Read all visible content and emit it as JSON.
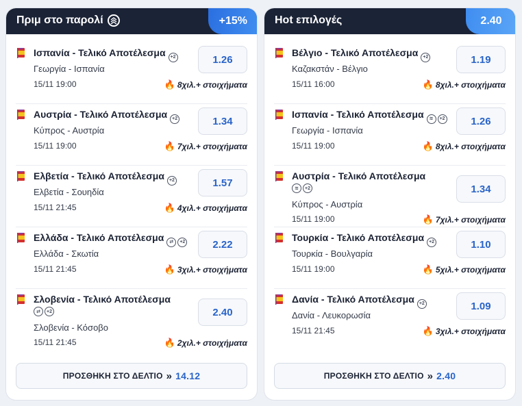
{
  "left": {
    "title": "Πριμ στο παρολί",
    "badge": "+15%",
    "button_label": "ΠΡΟΣΘΗΚΗ ΣΤΟ ΔΕΛΤΙΟ",
    "button_total": "14.12",
    "items": [
      {
        "title": "Ισπανία - Τελικό Αποτέλεσμα",
        "teams": "Γεωργία - Ισπανία",
        "time": "15/11 19:00",
        "odds": "1.26",
        "bets": "8χιλ.+ στοιχήματα",
        "badges": [
          "+2"
        ]
      },
      {
        "title": "Αυστρία - Τελικό Αποτέλεσμα",
        "teams": "Κύπρος - Αυστρία",
        "time": "15/11 19:00",
        "odds": "1.34",
        "bets": "7χιλ.+ στοιχήματα",
        "badges": [
          "+2"
        ]
      },
      {
        "title": "Ελβετία - Τελικό Αποτέλεσμα",
        "teams": "Ελβετία - Σουηδία",
        "time": "15/11 21:45",
        "odds": "1.57",
        "bets": "4χιλ.+ στοιχήματα",
        "badges": [
          "+2"
        ]
      },
      {
        "title": "Ελλάδα - Τελικό Αποτέλεσμα",
        "teams": "Ελλάδα - Σκωτία",
        "time": "15/11 21:45",
        "odds": "2.22",
        "bets": "3χιλ.+ στοιχήματα",
        "badges": [
          "eb",
          "+2"
        ]
      },
      {
        "title": "Σλοβενία - Τελικό Αποτέλεσμα",
        "teams": "Σλοβενία - Κόσοβο",
        "time": "15/11 21:45",
        "odds": "2.40",
        "bets": "2χιλ.+ στοιχήματα",
        "badges": [
          "eb",
          "+2"
        ]
      }
    ]
  },
  "right": {
    "title": "Hot επιλογές",
    "badge": "2.40",
    "button_label": "ΠΡΟΣΘΗΚΗ ΣΤΟ ΔΕΛΤΙΟ",
    "button_total": "2.40",
    "items": [
      {
        "title": "Βέλγιο - Τελικό Αποτέλεσμα",
        "teams": "Καζακστάν - Βέλγιο",
        "time": "15/11 16:00",
        "odds": "1.19",
        "bets": "8χιλ.+ στοιχήματα",
        "badges": [
          "+2"
        ]
      },
      {
        "title": "Ισπανία - Τελικό Αποτέλεσμα",
        "teams": "Γεωργία - Ισπανία",
        "time": "15/11 19:00",
        "odds": "1.26",
        "bets": "8χιλ.+ στοιχήματα",
        "badges": [
          "boost",
          "+2"
        ]
      },
      {
        "title": "Αυστρία - Τελικό Αποτέλεσμα",
        "teams": "Κύπρος - Αυστρία",
        "time": "15/11 19:00",
        "odds": "1.34",
        "bets": "7χιλ.+ στοιχήματα",
        "badges": [
          "boost",
          "+2"
        ]
      },
      {
        "title": "Τουρκία - Τελικό Αποτέλεσμα",
        "teams": "Τουρκία - Βουλγαρία",
        "time": "15/11 19:00",
        "odds": "1.10",
        "bets": "5χιλ.+ στοιχήματα",
        "badges": [
          "+2"
        ]
      },
      {
        "title": "Δανία - Τελικό Αποτέλεσμα",
        "teams": "Δανία - Λευκορωσία",
        "time": "15/11 21:45",
        "odds": "1.09",
        "bets": "3χιλ.+ στοιχήματα",
        "badges": [
          "+2"
        ]
      }
    ]
  },
  "icons": {
    "boost": "boost-icon",
    "fire": "fire-icon",
    "chevron": "double-chevron-right-icon",
    "flag": "country-flag-icon",
    "early_bird": "early-payout-icon",
    "plus2": "plus-two-goals-icon"
  },
  "colors": {
    "header": "#1b2336",
    "badge_blue": "#2b6fe0",
    "odds_text": "#2a64c9",
    "fire": "#f06a1c"
  }
}
